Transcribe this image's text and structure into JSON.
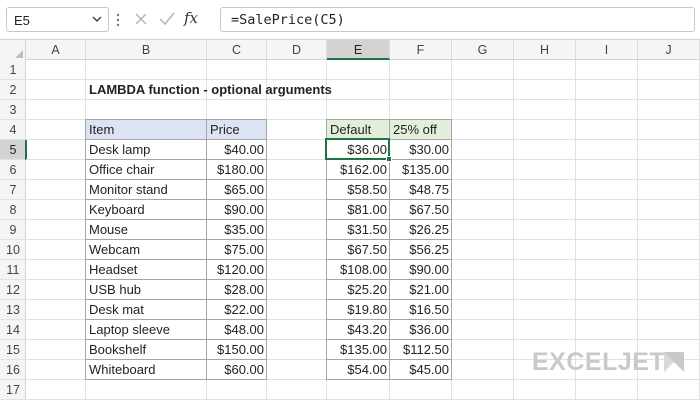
{
  "formula_bar": {
    "name_box": "E5",
    "fx_label": "fx",
    "formula": "=SalePrice(C5)"
  },
  "columns": [
    "A",
    "B",
    "C",
    "D",
    "E",
    "F",
    "G",
    "H",
    "I",
    "J"
  ],
  "rows": [
    "1",
    "2",
    "3",
    "4",
    "5",
    "6",
    "7",
    "8",
    "9",
    "10",
    "11",
    "12",
    "13",
    "14",
    "15",
    "16",
    "17"
  ],
  "selected": {
    "column": "E",
    "row": "5"
  },
  "title": "LAMBDA function - optional arguments",
  "table_left": {
    "header_item": "Item",
    "header_price": "Price",
    "rows": [
      {
        "item": "Desk lamp",
        "price": "$40.00"
      },
      {
        "item": "Office chair",
        "price": "$180.00"
      },
      {
        "item": "Monitor stand",
        "price": "$65.00"
      },
      {
        "item": "Keyboard",
        "price": "$90.00"
      },
      {
        "item": "Mouse",
        "price": "$35.00"
      },
      {
        "item": "Webcam",
        "price": "$75.00"
      },
      {
        "item": "Headset",
        "price": "$120.00"
      },
      {
        "item": "USB hub",
        "price": "$28.00"
      },
      {
        "item": "Desk mat",
        "price": "$22.00"
      },
      {
        "item": "Laptop sleeve",
        "price": "$48.00"
      },
      {
        "item": "Bookshelf",
        "price": "$150.00"
      },
      {
        "item": "Whiteboard",
        "price": "$60.00"
      }
    ]
  },
  "table_right": {
    "header_default": "Default",
    "header_off": "25% off",
    "rows": [
      {
        "default": "$36.00",
        "off": "$30.00"
      },
      {
        "default": "$162.00",
        "off": "$135.00"
      },
      {
        "default": "$58.50",
        "off": "$48.75"
      },
      {
        "default": "$81.00",
        "off": "$67.50"
      },
      {
        "default": "$31.50",
        "off": "$26.25"
      },
      {
        "default": "$67.50",
        "off": "$56.25"
      },
      {
        "default": "$108.00",
        "off": "$90.00"
      },
      {
        "default": "$25.20",
        "off": "$21.00"
      },
      {
        "default": "$19.80",
        "off": "$16.50"
      },
      {
        "default": "$43.20",
        "off": "$36.00"
      },
      {
        "default": "$135.00",
        "off": "$112.50"
      },
      {
        "default": "$54.00",
        "off": "$45.00"
      }
    ]
  },
  "logo": {
    "text": "EXCELJET"
  },
  "colors": {
    "accent": "#217346",
    "header_blue": "#dce3f2",
    "header_green": "#e2efda"
  }
}
